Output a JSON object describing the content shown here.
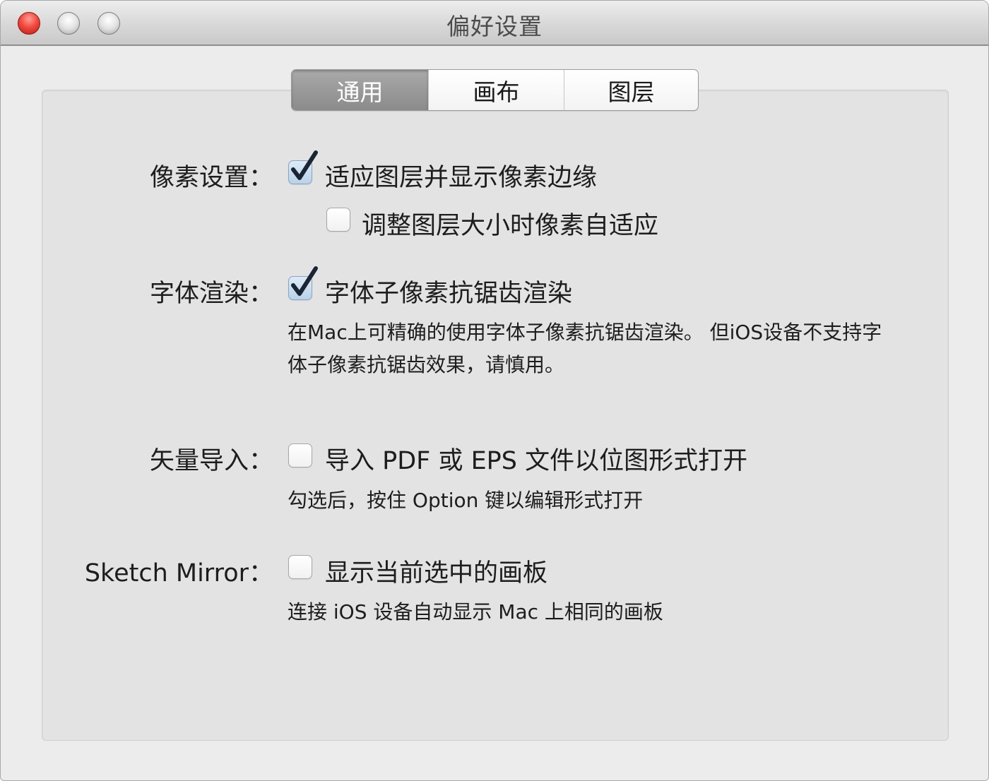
{
  "window": {
    "title": "偏好设置"
  },
  "tabs": [
    {
      "label": "通用",
      "active": true
    },
    {
      "label": "画布",
      "active": false
    },
    {
      "label": "图层",
      "active": false
    }
  ],
  "settings": {
    "pixel": {
      "label": "像素设置：",
      "options": [
        {
          "text": "适应图层并显示像素边缘",
          "checked": true
        },
        {
          "text": "调整图层大小时像素自适应",
          "checked": false
        }
      ]
    },
    "font": {
      "label": "字体渲染：",
      "option": {
        "text": "字体子像素抗锯齿渲染",
        "checked": true
      },
      "description_line1": "在Mac上可精确的使用字体子像素抗锯齿渲染。 但iOS设备不支持字",
      "description_line2": "体子像素抗锯齿效果，请慎用。"
    },
    "vector": {
      "label": "矢量导入：",
      "option": {
        "text": "导入 PDF 或 EPS 文件以位图形式打开",
        "checked": false
      },
      "description": "勾选后，按住 Option 键以编辑形式打开"
    },
    "mirror": {
      "label": "Sketch Mirror：",
      "option": {
        "text": "显示当前选中的画板",
        "checked": false
      },
      "description": "连接 iOS 设备自动显示 Mac 上相同的画板"
    }
  },
  "colors": {
    "close_button": "#f24c40",
    "active_tab": "#8b8b8b",
    "checkmark": "#1a2433"
  }
}
